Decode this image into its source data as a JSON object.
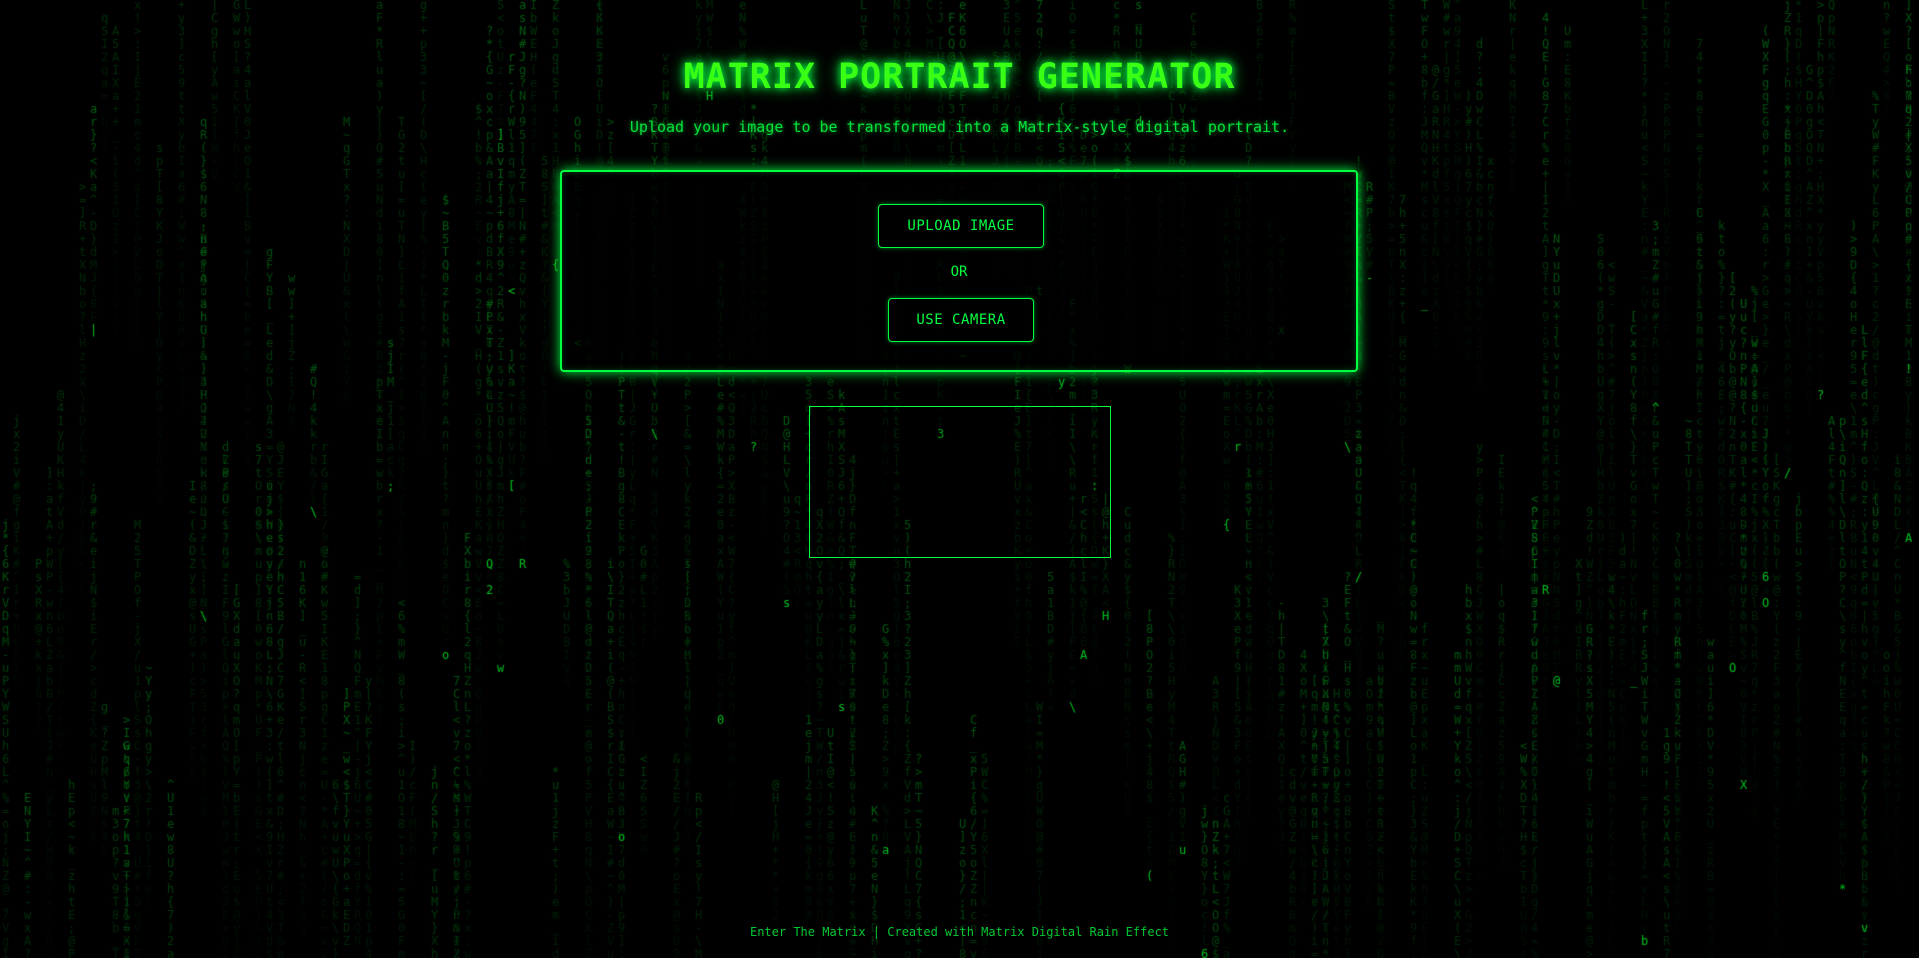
{
  "header": {
    "title": "MATRIX PORTRAIT GENERATOR",
    "subtitle": "Upload your image to be transformed into a Matrix-style digital portrait."
  },
  "upload_panel": {
    "upload_button": "UPLOAD IMAGE",
    "or_text": "OR",
    "camera_button": "USE CAMERA"
  },
  "footer": {
    "text": "Enter The Matrix | Created with Matrix Digital Rain Effect"
  },
  "theme": {
    "background": "#000000",
    "accent": "#00ff41",
    "title_color": "#39ff14"
  },
  "background_effect": {
    "glyph_set": "ABCDEFGHIJKLMNOPQRSTUVWXYZabcdefghijklmnopqrstuvwxyz0123456789!@#$%^&*()[]{}<>/\\|~+=-_;:?"
  }
}
